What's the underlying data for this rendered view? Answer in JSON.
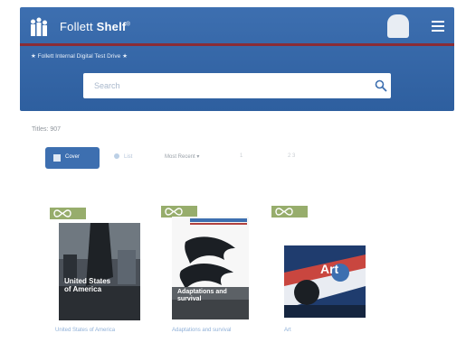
{
  "header": {
    "brand_regular": "Follett",
    "brand_bold": "Shelf",
    "trademark": "®",
    "collection_name": "★ Follett Internal Digital Test Drive ★"
  },
  "search": {
    "placeholder": "Search"
  },
  "results": {
    "titles_count": "Titles: 907"
  },
  "view": {
    "cover_label": "Cover",
    "list_label": "List",
    "sort_label": "Most Recent ▾",
    "pager_a": "1",
    "pager_b": "2 3"
  },
  "books": [
    {
      "title": "United States of America",
      "cover_text": "United States of America",
      "format": "audio-ebook"
    },
    {
      "title": "Adaptations and survival",
      "cover_text": "Adaptations and survival",
      "format": "audio-ebook"
    },
    {
      "title": "Art",
      "cover_text": "Art",
      "format": "audio-ebook"
    }
  ],
  "colors": {
    "header_blue": "#3d6fb0",
    "accent_red": "#8a2c35",
    "badge_green": "#97ad6c",
    "link_blue": "#8fb0d8"
  },
  "icons": {
    "logo": "people-icon",
    "search": "search-icon",
    "menu": "hamburger-icon",
    "badge": "infinity-icon"
  }
}
